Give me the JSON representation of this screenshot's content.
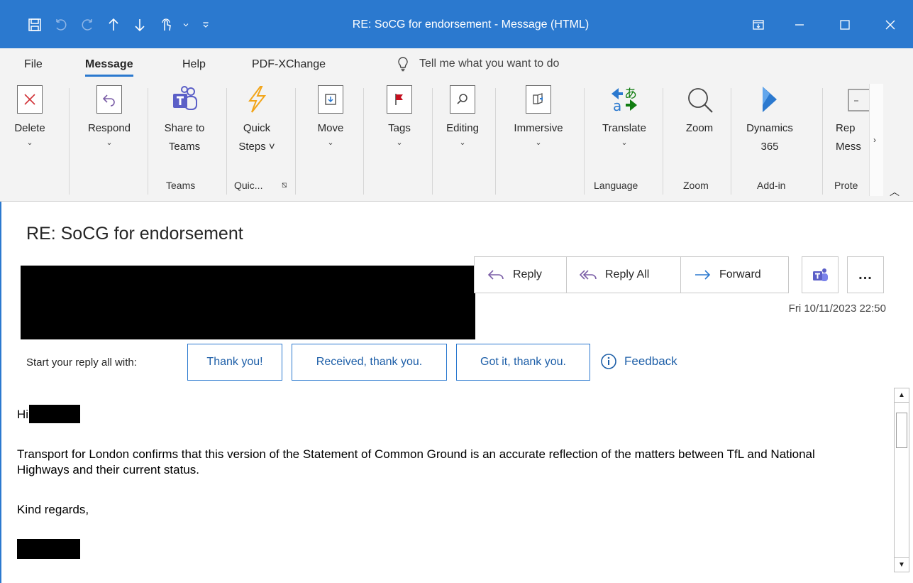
{
  "window": {
    "title": "RE: SoCG for endorsement  -  Message (HTML)"
  },
  "menu": {
    "tabs": [
      "File",
      "Message",
      "Help",
      "PDF-XChange"
    ],
    "active": "Message",
    "tell_me": "Tell me what you want to do"
  },
  "ribbon": {
    "buttons": [
      {
        "label1": "Delete",
        "label2": "",
        "chevron": true
      },
      {
        "label1": "Respond",
        "label2": "",
        "chevron": true
      },
      {
        "label1": "Share to",
        "label2": "Teams",
        "chevron": false
      },
      {
        "label1": "Quick",
        "label2": "Steps ˅",
        "chevron": false
      },
      {
        "label1": "Move",
        "label2": "",
        "chevron": true
      },
      {
        "label1": "Tags",
        "label2": "",
        "chevron": true
      },
      {
        "label1": "Editing",
        "label2": "",
        "chevron": true
      },
      {
        "label1": "Immersive",
        "label2": "",
        "chevron": true
      },
      {
        "label1": "Translate",
        "label2": "",
        "chevron": true
      },
      {
        "label1": "Zoom",
        "label2": "",
        "chevron": false
      },
      {
        "label1": "Dynamics",
        "label2": "365",
        "chevron": false
      },
      {
        "label1": "Rep",
        "label2": "Mess",
        "chevron": false
      }
    ],
    "groups": [
      "Teams",
      "Quic...",
      "Language",
      "Zoom",
      "Add-in",
      "Prote"
    ]
  },
  "message": {
    "subject": "RE: SoCG for endorsement",
    "actions": {
      "reply": "Reply",
      "reply_all": "Reply All",
      "forward": "Forward",
      "more": "..."
    },
    "date": "Fri 10/11/2023 22:50",
    "suggest_label": "Start your reply all with:",
    "suggestions": [
      "Thank you!",
      "Received, thank you.",
      "Got it, thank you."
    ],
    "feedback": "Feedback",
    "body": {
      "greeting": "Hi",
      "paragraph": "Transport for London confirms that this version of the Statement of Common Ground is an accurate reflection of the matters between TfL and National Highways and their current status.",
      "closing": "Kind regards,"
    }
  },
  "colors": {
    "accent": "#2b79cf",
    "delete_red": "#d13438",
    "respond_purple": "#7b5ea7",
    "teams_purple": "#5b5fc7",
    "quicksteps_orange": "#f2a51a",
    "flag_red": "#c50f1f",
    "translate_green": "#107c10"
  }
}
